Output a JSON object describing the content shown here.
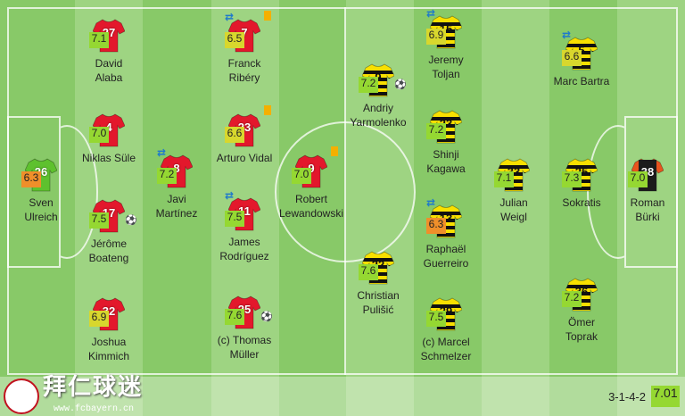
{
  "colors": {
    "bayern": "#e3182c",
    "bvb": "#f8e000",
    "gk_home": "#5ec12e",
    "gk_away": "#e8541e"
  },
  "players": [
    {
      "id": "ulreich",
      "name": "Sven\nUlreich",
      "number": "26",
      "rating": "6.3",
      "rating_class": "r-o",
      "kit": "gk_home",
      "swap": false,
      "card": false,
      "goal": false
    },
    {
      "id": "sule",
      "name": "Niklas Süle",
      "number": "4",
      "rating": "7.0",
      "rating_class": "r-lg",
      "kit": "bayern",
      "swap": false,
      "card": false,
      "goal": false
    },
    {
      "id": "alaba",
      "name": "David\nAlaba",
      "number": "27",
      "rating": "7.1",
      "rating_class": "r-lg",
      "kit": "bayern",
      "swap": false,
      "card": false,
      "goal": false
    },
    {
      "id": "boateng",
      "name": "Jérôme\nBoateng",
      "number": "17",
      "rating": "7.5",
      "rating_class": "r-lg",
      "kit": "bayern",
      "swap": false,
      "card": false,
      "goal": true
    },
    {
      "id": "kimmich",
      "name": "Joshua\nKimmich",
      "number": "32",
      "rating": "6.9",
      "rating_class": "r-y",
      "kit": "bayern",
      "swap": false,
      "card": false,
      "goal": false
    },
    {
      "id": "martinez",
      "name": "Javi\nMartínez",
      "number": "8",
      "rating": "7.2",
      "rating_class": "r-lg",
      "kit": "bayern",
      "swap": true,
      "card": false,
      "goal": false
    },
    {
      "id": "ribery",
      "name": "Franck\nRibéry",
      "number": "7",
      "rating": "6.5",
      "rating_class": "r-y",
      "kit": "bayern",
      "swap": true,
      "card": true,
      "goal": false
    },
    {
      "id": "vidal",
      "name": "Arturo Vidal",
      "number": "23",
      "rating": "6.6",
      "rating_class": "r-y",
      "kit": "bayern",
      "swap": false,
      "card": true,
      "goal": false
    },
    {
      "id": "rodriguez",
      "name": "James\nRodríguez",
      "number": "11",
      "rating": "7.5",
      "rating_class": "r-lg",
      "kit": "bayern",
      "swap": true,
      "card": false,
      "goal": false
    },
    {
      "id": "muller",
      "name": "(c) Thomas\nMüller",
      "number": "25",
      "rating": "7.6",
      "rating_class": "r-lg",
      "kit": "bayern",
      "swap": false,
      "card": false,
      "goal": true
    },
    {
      "id": "lewandowski",
      "name": "Robert\nLewandowski",
      "number": "9",
      "rating": "7.0",
      "rating_class": "r-lg",
      "kit": "bayern",
      "swap": false,
      "card": true,
      "goal": false
    },
    {
      "id": "yarmolenko",
      "name": "Andriy\nYarmolenko",
      "number": "9",
      "rating": "7.2",
      "rating_class": "r-lg",
      "kit": "bvb",
      "swap": false,
      "card": false,
      "goal": true
    },
    {
      "id": "pulisic",
      "name": "Christian\nPulišić",
      "number": "22",
      "rating": "7.6",
      "rating_class": "r-lg",
      "kit": "bvb",
      "swap": false,
      "card": false,
      "goal": false
    },
    {
      "id": "toljan",
      "name": "Jeremy\nToljan",
      "number": "15",
      "rating": "6.9",
      "rating_class": "r-y",
      "kit": "bvb",
      "swap": true,
      "card": false,
      "goal": false
    },
    {
      "id": "kagawa",
      "name": "Shinji\nKagawa",
      "number": "23",
      "rating": "7.2",
      "rating_class": "r-lg",
      "kit": "bvb",
      "swap": false,
      "card": false,
      "goal": false
    },
    {
      "id": "guerreiro",
      "name": "Raphaël\nGuerreiro",
      "number": "13",
      "rating": "6.3",
      "rating_class": "r-o",
      "kit": "bvb",
      "swap": true,
      "card": false,
      "goal": false
    },
    {
      "id": "schmelzer",
      "name": "(c) Marcel\nSchmelzer",
      "number": "29",
      "rating": "7.5",
      "rating_class": "r-lg",
      "kit": "bvb",
      "swap": false,
      "card": false,
      "goal": false
    },
    {
      "id": "weigl",
      "name": "Julian\nWeigl",
      "number": "33",
      "rating": "7.1",
      "rating_class": "r-lg",
      "kit": "bvb",
      "swap": false,
      "card": false,
      "goal": false
    },
    {
      "id": "bartra",
      "name": "Marc Bartra",
      "number": "5",
      "rating": "6.6",
      "rating_class": "r-y",
      "kit": "bvb",
      "swap": true,
      "card": false,
      "goal": false
    },
    {
      "id": "sokratis",
      "name": "Sokratis",
      "number": "25",
      "rating": "7.3",
      "rating_class": "r-lg",
      "kit": "bvb",
      "swap": false,
      "card": false,
      "goal": false
    },
    {
      "id": "toprak",
      "name": "Ömer\nToprak",
      "number": "36",
      "rating": "7.2",
      "rating_class": "r-lg",
      "kit": "bvb",
      "swap": false,
      "card": false,
      "goal": false
    },
    {
      "id": "burki",
      "name": "Roman\nBürki",
      "number": "38",
      "rating": "7.0",
      "rating_class": "r-lg",
      "kit": "gk_away",
      "swap": false,
      "card": false,
      "goal": false
    }
  ],
  "footer": {
    "brand": "拜仁球迷",
    "brand_url": "www.fcbayern.cn",
    "formation": "3-1-4-2",
    "team_rating": "7.01"
  }
}
